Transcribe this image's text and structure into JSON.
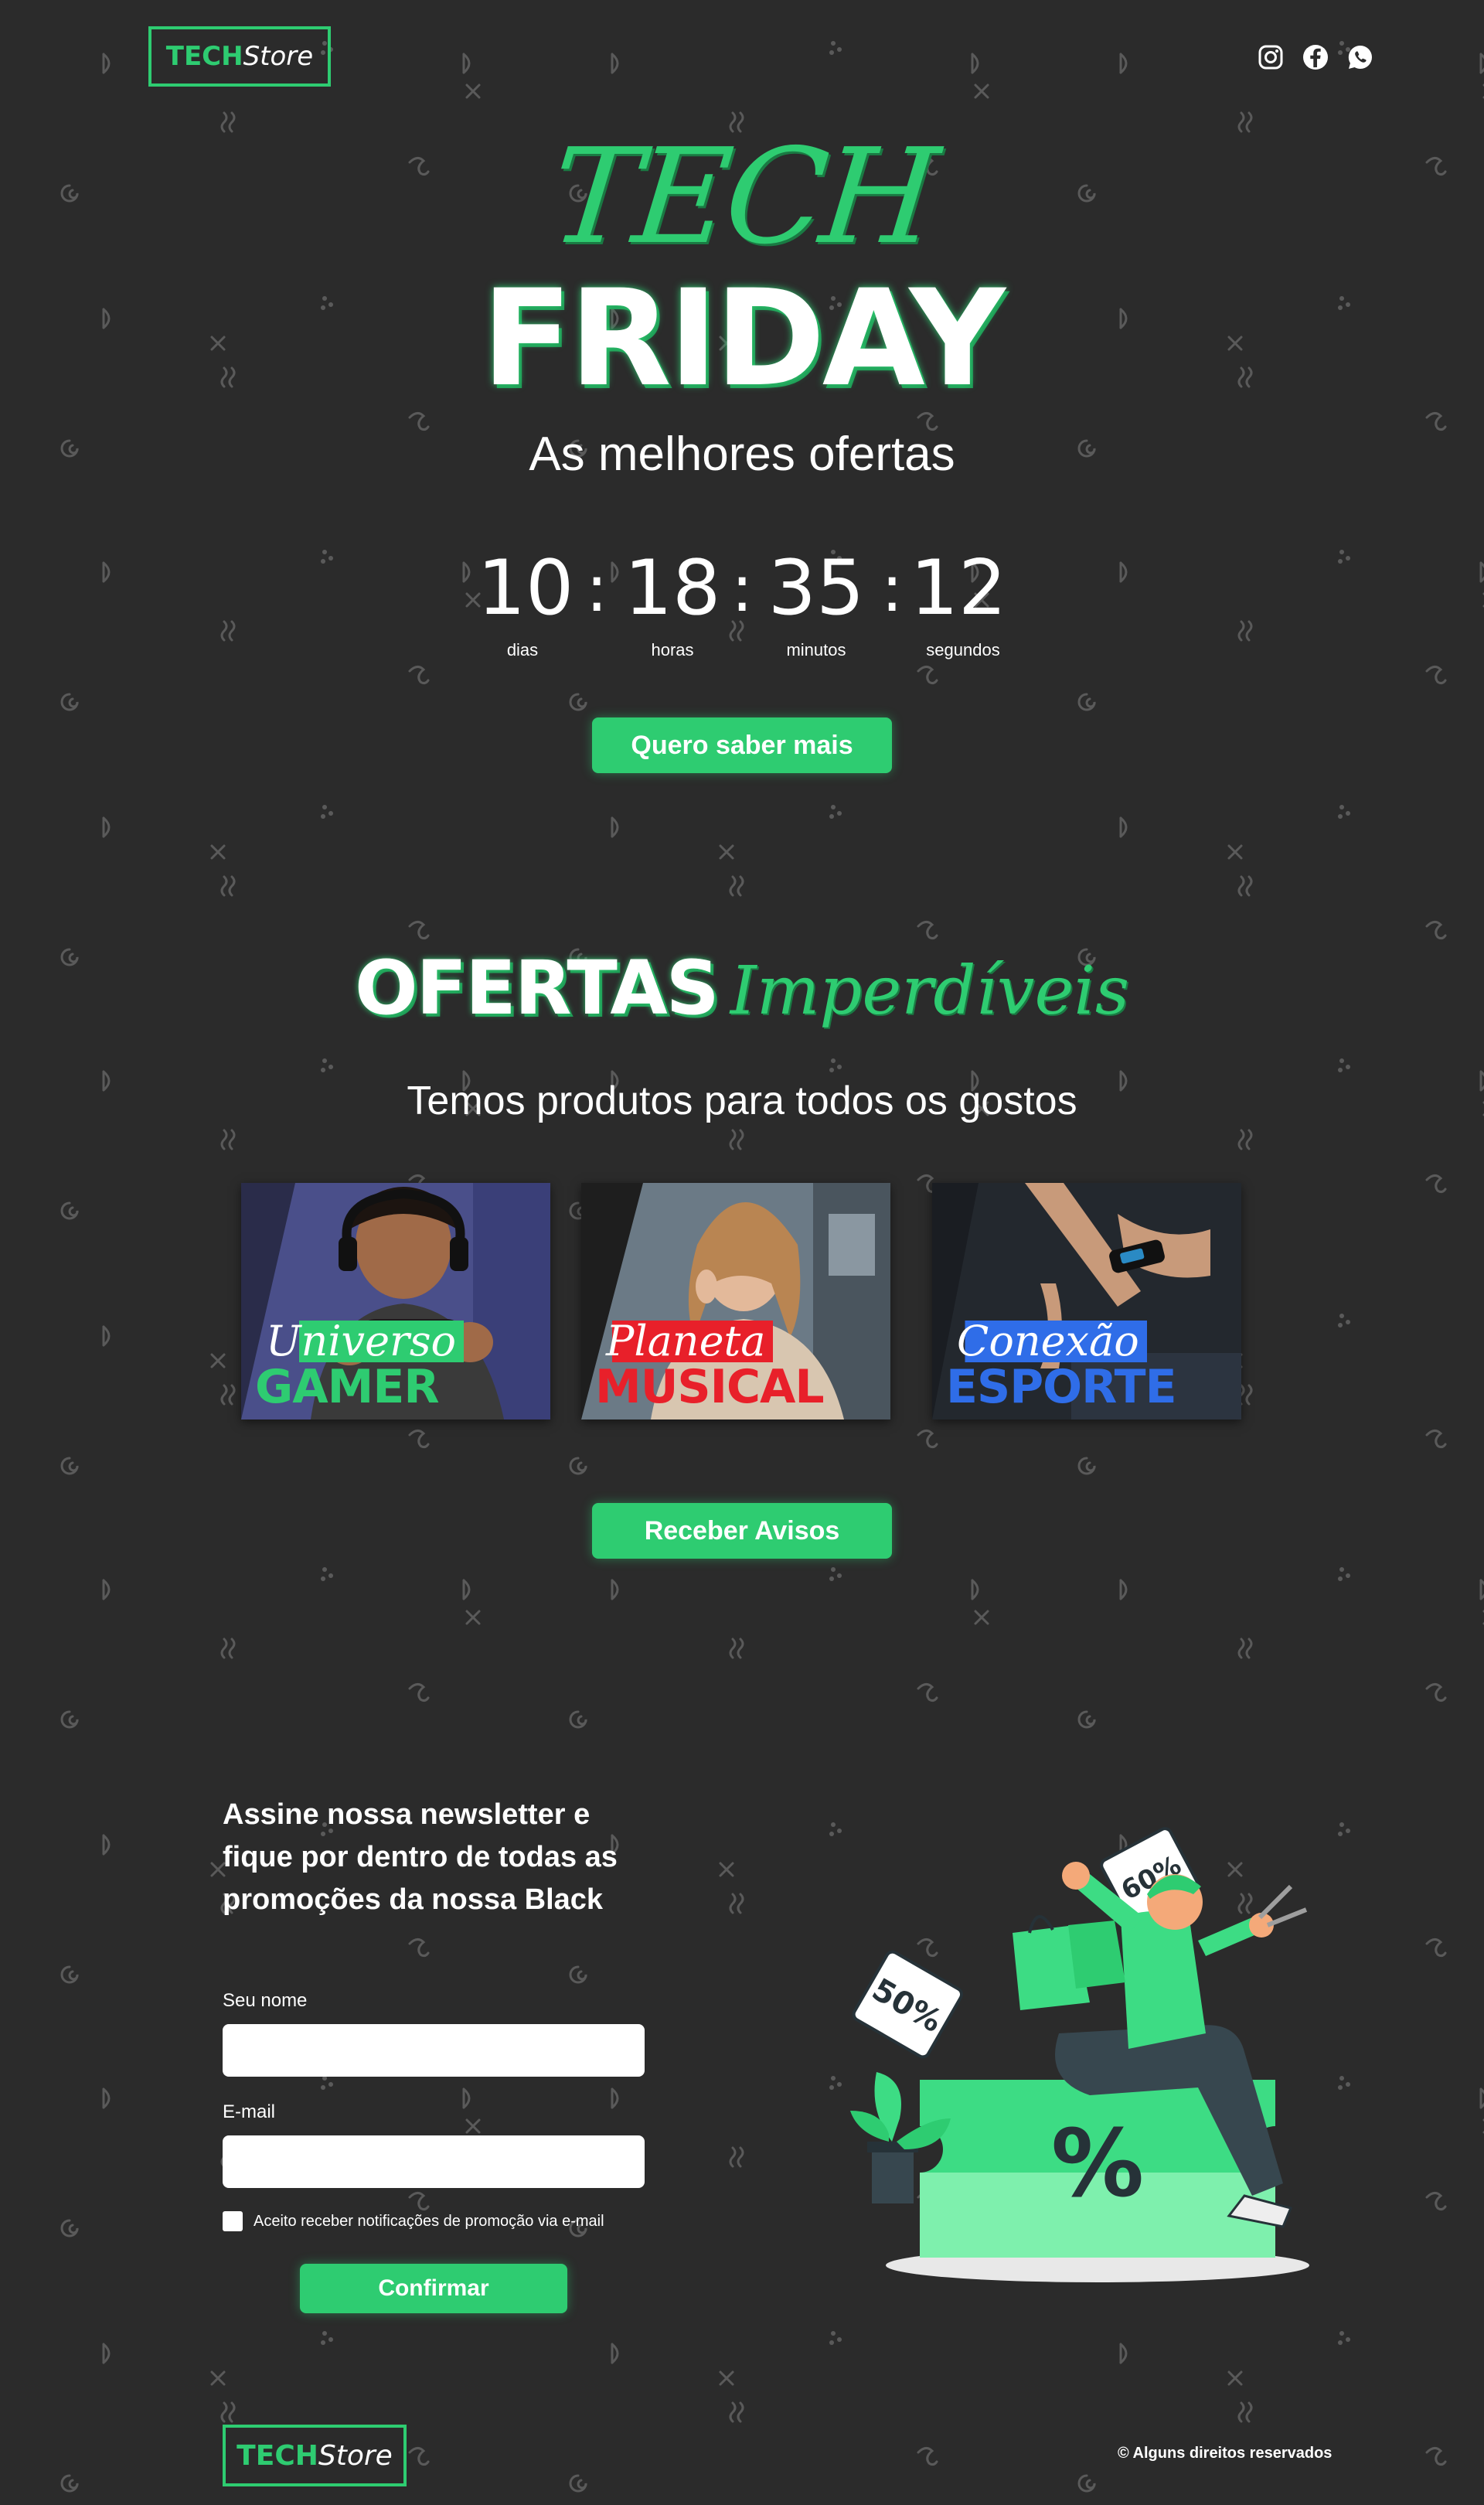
{
  "header": {
    "logo_tech": "TECH",
    "logo_store": "Store",
    "social": [
      {
        "icon": "instagram-icon"
      },
      {
        "icon": "facebook-icon"
      },
      {
        "icon": "whatsapp-icon"
      }
    ]
  },
  "hero": {
    "title_line1": "TECH",
    "title_line2": "FRIDAY",
    "subtitle": "As melhores ofertas",
    "countdown": {
      "days": "10",
      "hours": "18",
      "minutes": "35",
      "seconds": "12",
      "separator": ":",
      "days_label": "dias",
      "hours_label": "horas",
      "minutes_label": "minutos",
      "seconds_label": "segundos"
    },
    "cta_label": "Quero saber mais"
  },
  "offers": {
    "title_bold": "OFERTAS",
    "title_script": "Imperdíveis",
    "subtitle": "Temos produtos para todos os gostos",
    "cards": [
      {
        "line1": "Universo",
        "line2": "GAMER",
        "accent": "#2ecc71"
      },
      {
        "line1": "Planeta",
        "line2": "MUSICAL",
        "accent": "#e8202a"
      },
      {
        "line1": "Conexão",
        "line2": "ESPORTE",
        "accent": "#2f6de8"
      }
    ],
    "cta_label": "Receber Avisos"
  },
  "newsletter": {
    "title": "Assine nossa newsletter e fique por dentro de todas as promoções da nossa Black",
    "name_label": "Seu nome",
    "name_value": "",
    "email_label": "E-mail",
    "email_value": "",
    "consent_label": "Aceito receber notificações de promoção via e-mail",
    "consent_checked": false,
    "submit_label": "Confirmar",
    "illustration_tags": [
      "60%",
      "50%",
      "%"
    ]
  },
  "footer": {
    "logo_tech": "TECH",
    "logo_store": "Store",
    "copyright": "© Alguns direitos reservados"
  },
  "colors": {
    "background": "#2b2b2b",
    "accent": "#2ecc71",
    "text": "#ffffff"
  }
}
